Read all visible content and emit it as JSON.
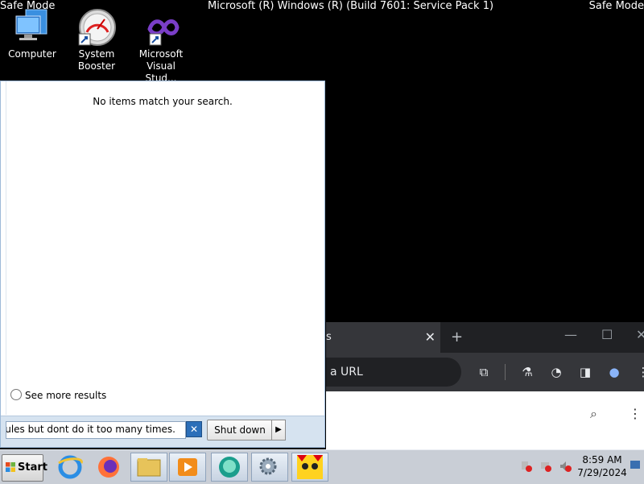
{
  "desktop": {
    "safe_mode_left": "Safe Mode",
    "safe_mode_right": "Safe Mode",
    "build_text": "Microsoft (R) Windows (R) (Build 7601: Service Pack 1)",
    "icons": [
      {
        "label": "Computer",
        "icon": "computer-icon"
      },
      {
        "label": "System\nBooster",
        "icon": "speedometer-icon"
      },
      {
        "label": "Microsoft\nVisual Stud...",
        "icon": "visual-studio-icon"
      }
    ]
  },
  "browser": {
    "tab_title": "s",
    "omnibox_text": "a URL",
    "accent": "#202124"
  },
  "start_menu": {
    "no_results": "No items match your search.",
    "see_more": "See more results",
    "search_value": "the rules but dont do it too many times.",
    "shutdown_label": "Shut down"
  },
  "taskbar": {
    "start_label": "Start",
    "apps": [
      "internet-explorer-icon",
      "firefox-icon",
      "file-explorer-icon",
      "media-player-icon",
      "chat-app-icon",
      "settings-gears-icon",
      "cat-game-icon"
    ],
    "time": "8:59 AM",
    "date": "7/29/2024"
  }
}
